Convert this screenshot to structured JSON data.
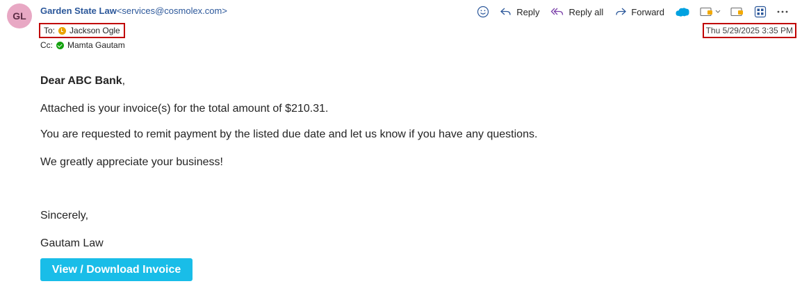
{
  "header": {
    "avatar_initials": "GL",
    "sender_name": "Garden State Law",
    "sender_email": "<services@cosmolex.com>",
    "to_label": "To:",
    "to_name": "Jackson Ogle",
    "cc_label": "Cc:",
    "cc_name": "Mamta Gautam",
    "timestamp": "Thu 5/29/2025 3:35 PM"
  },
  "toolbar": {
    "emoji_icon": "smiley-icon",
    "reply_label": "Reply",
    "reply_all_label": "Reply all",
    "forward_label": "Forward",
    "icons": [
      "salesforce-icon",
      "apps-dropdown-icon",
      "addin-icon",
      "grid-apps-icon",
      "more-icon"
    ]
  },
  "body": {
    "greeting_name": "Dear ABC Bank",
    "greeting_punct": ",",
    "line1": "Attached is your invoice(s) for the total amount of $210.31.",
    "line2": "You are requested to remit payment by the listed due date and let us know if you have any questions.",
    "line3": "We greatly appreciate your business!",
    "closing": "Sincerely,",
    "signature": "Gautam Law",
    "invoice_button": "View / Download Invoice"
  },
  "colors": {
    "accent": "#2b579a",
    "button": "#19bde8",
    "highlight_border": "#c00000",
    "avatar_bg": "#e8a8c4"
  }
}
